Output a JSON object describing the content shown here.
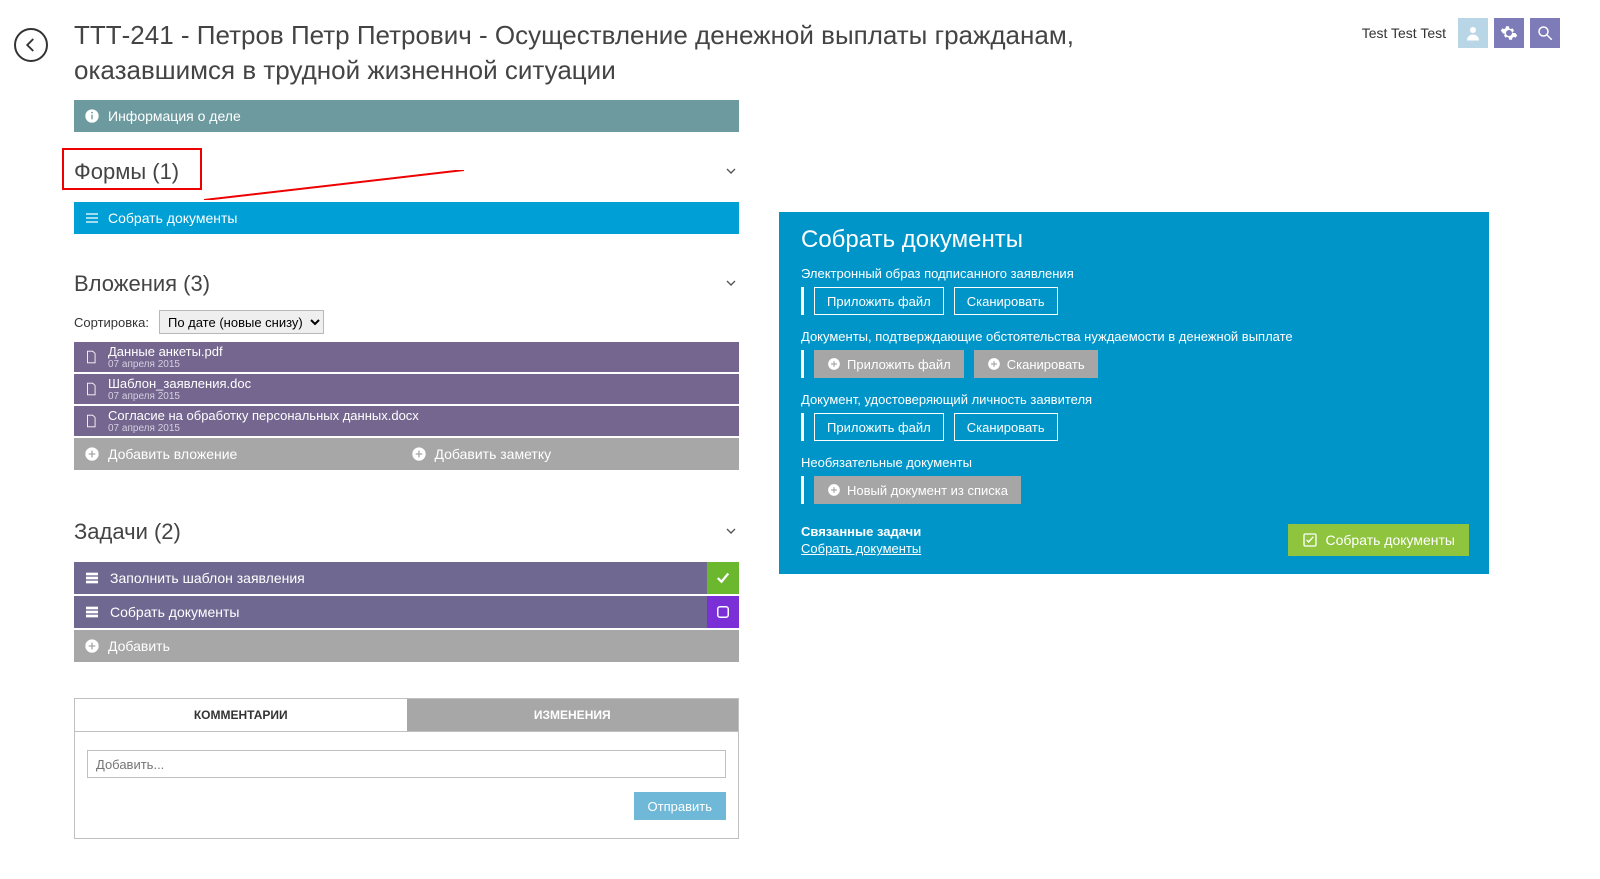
{
  "header": {
    "title": "ТТТ-241 -  Петров Петр  Петрович - Осуществление денежной выплаты гражданам, оказавшимся в трудной жизненной ситуации",
    "user": "Test Test Test"
  },
  "info_bar": "Информация о деле",
  "forms": {
    "heading": "Формы (1)",
    "collect": "Собрать документы"
  },
  "attachments": {
    "heading": "Вложения (3)",
    "sort_label": "Сортировка:",
    "sort_value": "По дате (новые снизу)",
    "items": [
      {
        "name": "Данные анкеты.pdf",
        "date": "07 апреля 2015"
      },
      {
        "name": "Шаблон_заявления.doc",
        "date": "07 апреля 2015"
      },
      {
        "name": "Согласие на обработку персональных данных.docx",
        "date": "07 апреля 2015"
      }
    ],
    "add_attach": "Добавить вложение",
    "add_note": "Добавить заметку"
  },
  "tasks": {
    "heading": "Задачи (2)",
    "items": [
      {
        "name": "Заполнить шаблон заявления",
        "status": "done"
      },
      {
        "name": "Собрать документы",
        "status": "pending"
      }
    ],
    "add": "Добавить"
  },
  "tabs": {
    "comments": "КОММЕНТАРИИ",
    "changes": "ИЗМЕНЕНИЯ",
    "placeholder": "Добавить...",
    "send": "Отправить"
  },
  "panel": {
    "title": "Собрать документы",
    "groups": [
      {
        "label": "Электронный образ подписанного заявления",
        "style": "outline"
      },
      {
        "label": "Документы, подтверждающие обстоятельства нуждаемости в денежной выплате",
        "style": "filled"
      },
      {
        "label": "Документ, удостоверяющий личность заявителя",
        "style": "outline"
      }
    ],
    "attach": "Приложить файл",
    "scan": "Сканировать",
    "optional_label": "Необязательные документы",
    "optional_btn": "Новый документ из списка",
    "related_heading": "Связанные задачи",
    "related_link": "Собрать документы",
    "submit": "Собрать документы"
  }
}
